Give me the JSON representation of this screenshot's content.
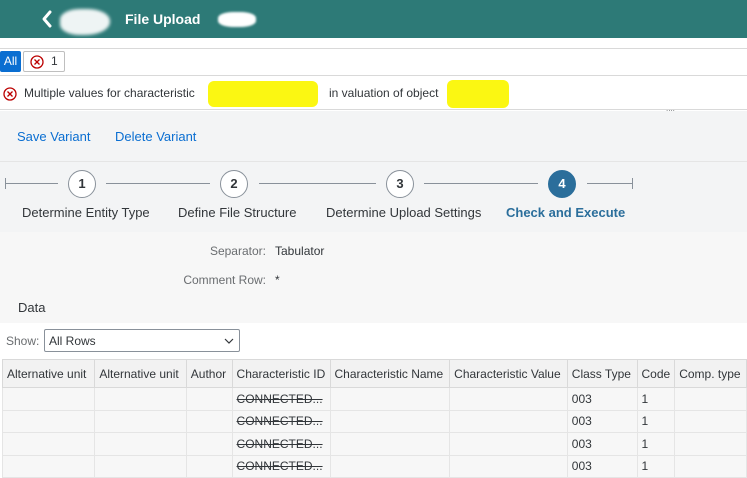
{
  "shell": {
    "title": "File Upload"
  },
  "messages": {
    "all_label": "All",
    "error_count": "1",
    "message_part1": "Multiple values for characteristic",
    "message_part2": "in valuation of object"
  },
  "toolbar": {
    "save_variant": "Save Variant",
    "delete_variant": "Delete Variant"
  },
  "wizard": {
    "steps": [
      {
        "number": "1",
        "label": "Determine Entity Type"
      },
      {
        "number": "2",
        "label": "Define File Structure"
      },
      {
        "number": "3",
        "label": "Determine Upload Settings"
      },
      {
        "number": "4",
        "label": "Check and Execute"
      }
    ],
    "active_step": 4
  },
  "form": {
    "separator_label": "Separator:",
    "separator_value": "Tabulator",
    "comment_row_label": "Comment Row:",
    "comment_row_value": "*"
  },
  "data_section": {
    "title": "Data",
    "show_label": "Show:",
    "show_value": "All Rows",
    "columns": [
      "Alternative unit",
      "Alternative unit",
      "Author",
      "Characteristic ID",
      "Characteristic Name",
      "Characteristic Value",
      "Class Type",
      "Code",
      "Comp. type"
    ],
    "rows": [
      [
        "",
        "",
        "",
        "CONNECTED...",
        "",
        "",
        "003",
        "1",
        ""
      ],
      [
        "",
        "",
        "",
        "CONNECTED...",
        "",
        "",
        "003",
        "1",
        ""
      ],
      [
        "",
        "",
        "",
        "CONNECTED...",
        "",
        "",
        "003",
        "1",
        ""
      ],
      [
        "",
        "",
        "",
        "CONNECTED...",
        "",
        "",
        "003",
        "1",
        ""
      ]
    ]
  },
  "colors": {
    "shell": "#2d7a77",
    "accent": "#0a6ed1",
    "active_step": "#2b6e9b",
    "error": "#bb0000",
    "highlight": "#fbf712"
  }
}
